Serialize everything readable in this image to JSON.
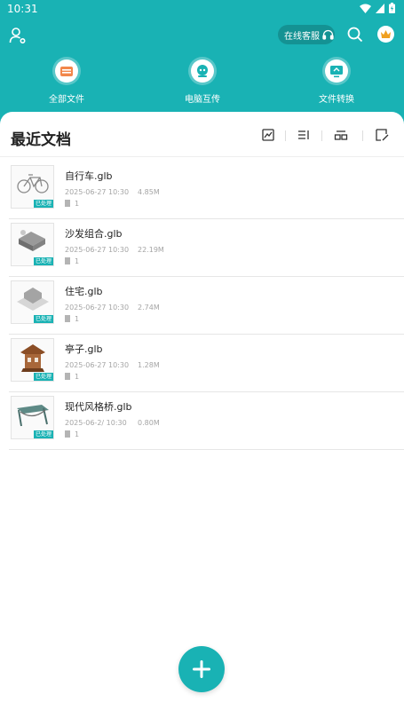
{
  "status_bar": {
    "time": "10:31"
  },
  "header": {
    "service_label": "在线客服"
  },
  "nav": [
    {
      "label": "全部文件",
      "icon": "folder-icon"
    },
    {
      "label": "电脑互传",
      "icon": "transfer-icon"
    },
    {
      "label": "文件转换",
      "icon": "convert-icon"
    }
  ],
  "section": {
    "title": "最近文档"
  },
  "files": [
    {
      "name": "自行车.glb",
      "date": "2025-06-27 10:30",
      "size": "4.85M",
      "pages": "1",
      "badge": "已处理"
    },
    {
      "name": "沙发组合.glb",
      "date": "2025-06-27 10:30",
      "size": "22.19M",
      "pages": "1",
      "badge": "已处理"
    },
    {
      "name": "住宅.glb",
      "date": "2025-06-27 10:30",
      "size": "2.74M",
      "pages": "1",
      "badge": "已处理"
    },
    {
      "name": "亭子.glb",
      "date": "2025-06-27 10:30",
      "size": "1.28M",
      "pages": "1",
      "badge": "已处理"
    },
    {
      "name": "现代风格桥.glb",
      "date": "2025-06-2/ 10:30",
      "size": "0.80M",
      "pages": "1",
      "badge": "已处理"
    }
  ],
  "colors": {
    "accent": "#19b2b4",
    "background": "#ffffff"
  }
}
